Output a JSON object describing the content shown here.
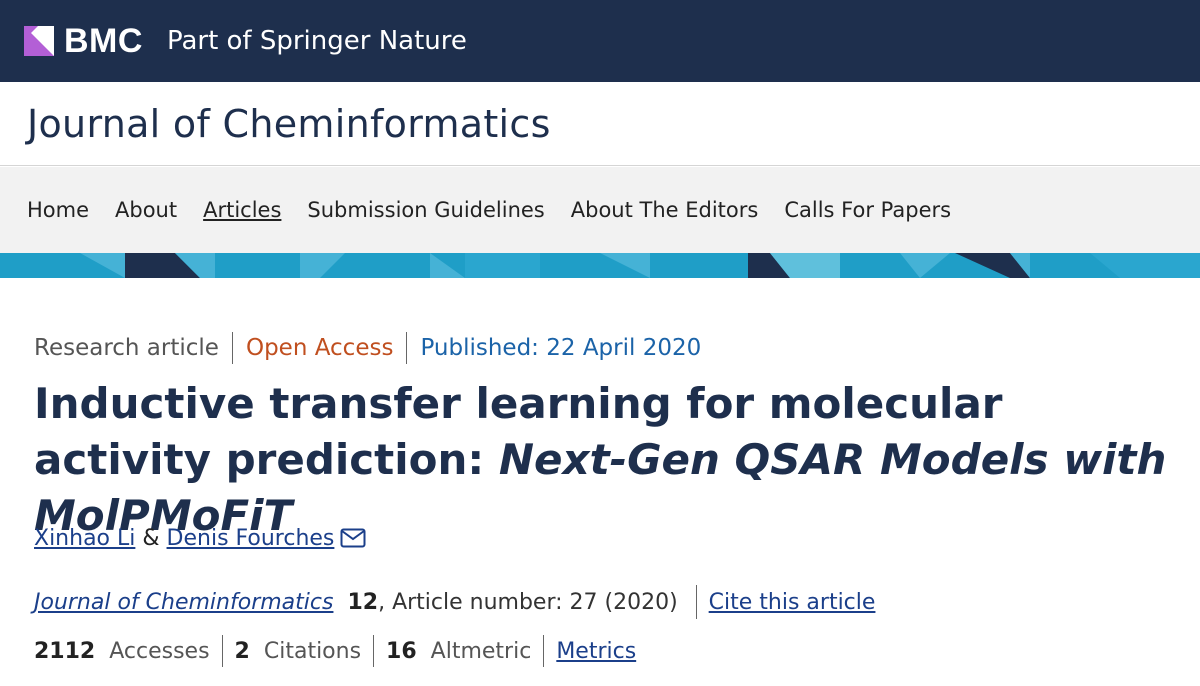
{
  "brand": {
    "name": "BMC",
    "tagline": "Part of Springer Nature",
    "logo_icon": "bmc-logo-icon",
    "colors": {
      "bar": "#1e2f4d",
      "mark": "#b35fd6"
    }
  },
  "journal": {
    "title": "Journal of Cheminformatics"
  },
  "nav": {
    "items": [
      {
        "label": "Home",
        "active": false
      },
      {
        "label": "About",
        "active": false
      },
      {
        "label": "Articles",
        "active": true
      },
      {
        "label": "Submission Guidelines",
        "active": false
      },
      {
        "label": "About The Editors",
        "active": false
      },
      {
        "label": "Calls For Papers",
        "active": false
      }
    ]
  },
  "banner": {
    "colors": {
      "base": "#1f9ec7",
      "dark": "#1e2f4d",
      "light": "#5fc0dc"
    }
  },
  "article": {
    "type": "Research article",
    "access": "Open Access",
    "published": "Published: 22 April 2020",
    "title_plain": "Inductive transfer learning for molecular activity prediction: ",
    "title_italic": "Next-Gen QSAR Models with MolPMoFiT",
    "authors": [
      {
        "name": "Xinhao Li"
      },
      {
        "name": "Denis Fourches",
        "has_email": true
      }
    ],
    "author_joiner": "&",
    "citation": {
      "journal": "Journal of Cheminformatics",
      "volume": "12",
      "rest": ", Article number: 27 (2020)",
      "cite_link": "Cite this article"
    },
    "metrics": {
      "accesses": {
        "value": "2112",
        "label": "Accesses"
      },
      "citations": {
        "value": "2",
        "label": "Citations"
      },
      "altmetric": {
        "value": "16",
        "label": "Altmetric"
      },
      "link": "Metrics"
    },
    "colors": {
      "title": "#1e2f4d",
      "open_access": "#c04f1f",
      "published": "#1b63a8",
      "link": "#1b3f8a"
    }
  }
}
